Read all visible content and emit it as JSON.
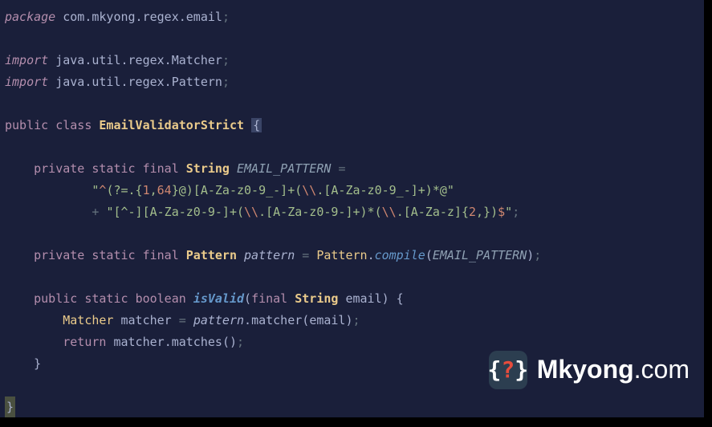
{
  "code": {
    "l1_kw": "package ",
    "l1_pkg": "com.mkyong.regex.email",
    "l1_end": ";",
    "l3_kw": "import ",
    "l3_pkg": "java.util.regex.Matcher",
    "l3_end": ";",
    "l4_kw": "import ",
    "l4_pkg": "java.util.regex.Pattern",
    "l4_end": ";",
    "l6_kw": "public class ",
    "l6_cls": "EmailValidatorStrict ",
    "l6_brace": "{",
    "l8_kw": "    private static final ",
    "l8_type": "String ",
    "l8_const": "EMAIL_PATTERN ",
    "l8_op": "=",
    "l9_pre": "            ",
    "l9_q1": "\"",
    "l9_s1": "^",
    "l9_s2": "(?=.{",
    "l9_n1": "1",
    "l9_s3": ",",
    "l9_n2": "64",
    "l9_s4": "}@)[A-Za-z0-9_-]+(",
    "l9_esc1": "\\\\",
    "l9_s5": ".[A-Za-z0-9_-]+)*@",
    "l9_q2": "\"",
    "l10_pre": "            ",
    "l10_plus": "+ ",
    "l10_q1": "\"",
    "l10_s1": "[^-][A-Za-z0-9-]+(",
    "l10_esc1": "\\\\",
    "l10_s2": ".[A-Za-z0-9-]+)*(",
    "l10_esc2": "\\\\",
    "l10_s3": ".[A-Za-z]{",
    "l10_n1": "2",
    "l10_s4": ",})",
    "l10_s5": "$",
    "l10_q2": "\"",
    "l10_end": ";",
    "l12_kw": "    private static final ",
    "l12_type": "Pattern ",
    "l12_var": "pattern ",
    "l12_op": "= ",
    "l12_cls": "Pattern",
    "l12_dot": ".",
    "l12_m": "compile",
    "l12_p1": "(",
    "l12_arg": "EMAIL_PATTERN",
    "l12_p2": ")",
    "l12_end": ";",
    "l14_kw1": "    public static ",
    "l14_ret": "boolean ",
    "l14_m": "isValid",
    "l14_p1": "(",
    "l14_kw2": "final ",
    "l14_type": "String ",
    "l14_arg": "email",
    "l14_p2": ") {",
    "l15_pre": "        ",
    "l15_type": "Matcher ",
    "l15_var": "matcher ",
    "l15_op": "= ",
    "l15_v2": "pattern",
    "l15_dot": ".",
    "l15_m": "matcher",
    "l15_p1": "(",
    "l15_arg": "email",
    "l15_p2": ")",
    "l15_end": ";",
    "l16_kw": "        return ",
    "l16_var": "matcher",
    "l16_dot": ".",
    "l16_m": "matches",
    "l16_p": "()",
    "l16_end": ";",
    "l17": "    }",
    "l19": "}"
  },
  "watermark": {
    "brace_l": "{",
    "q": "?",
    "brace_r": "}",
    "name_bold": "Mkyong",
    "name_thin": ".com"
  }
}
